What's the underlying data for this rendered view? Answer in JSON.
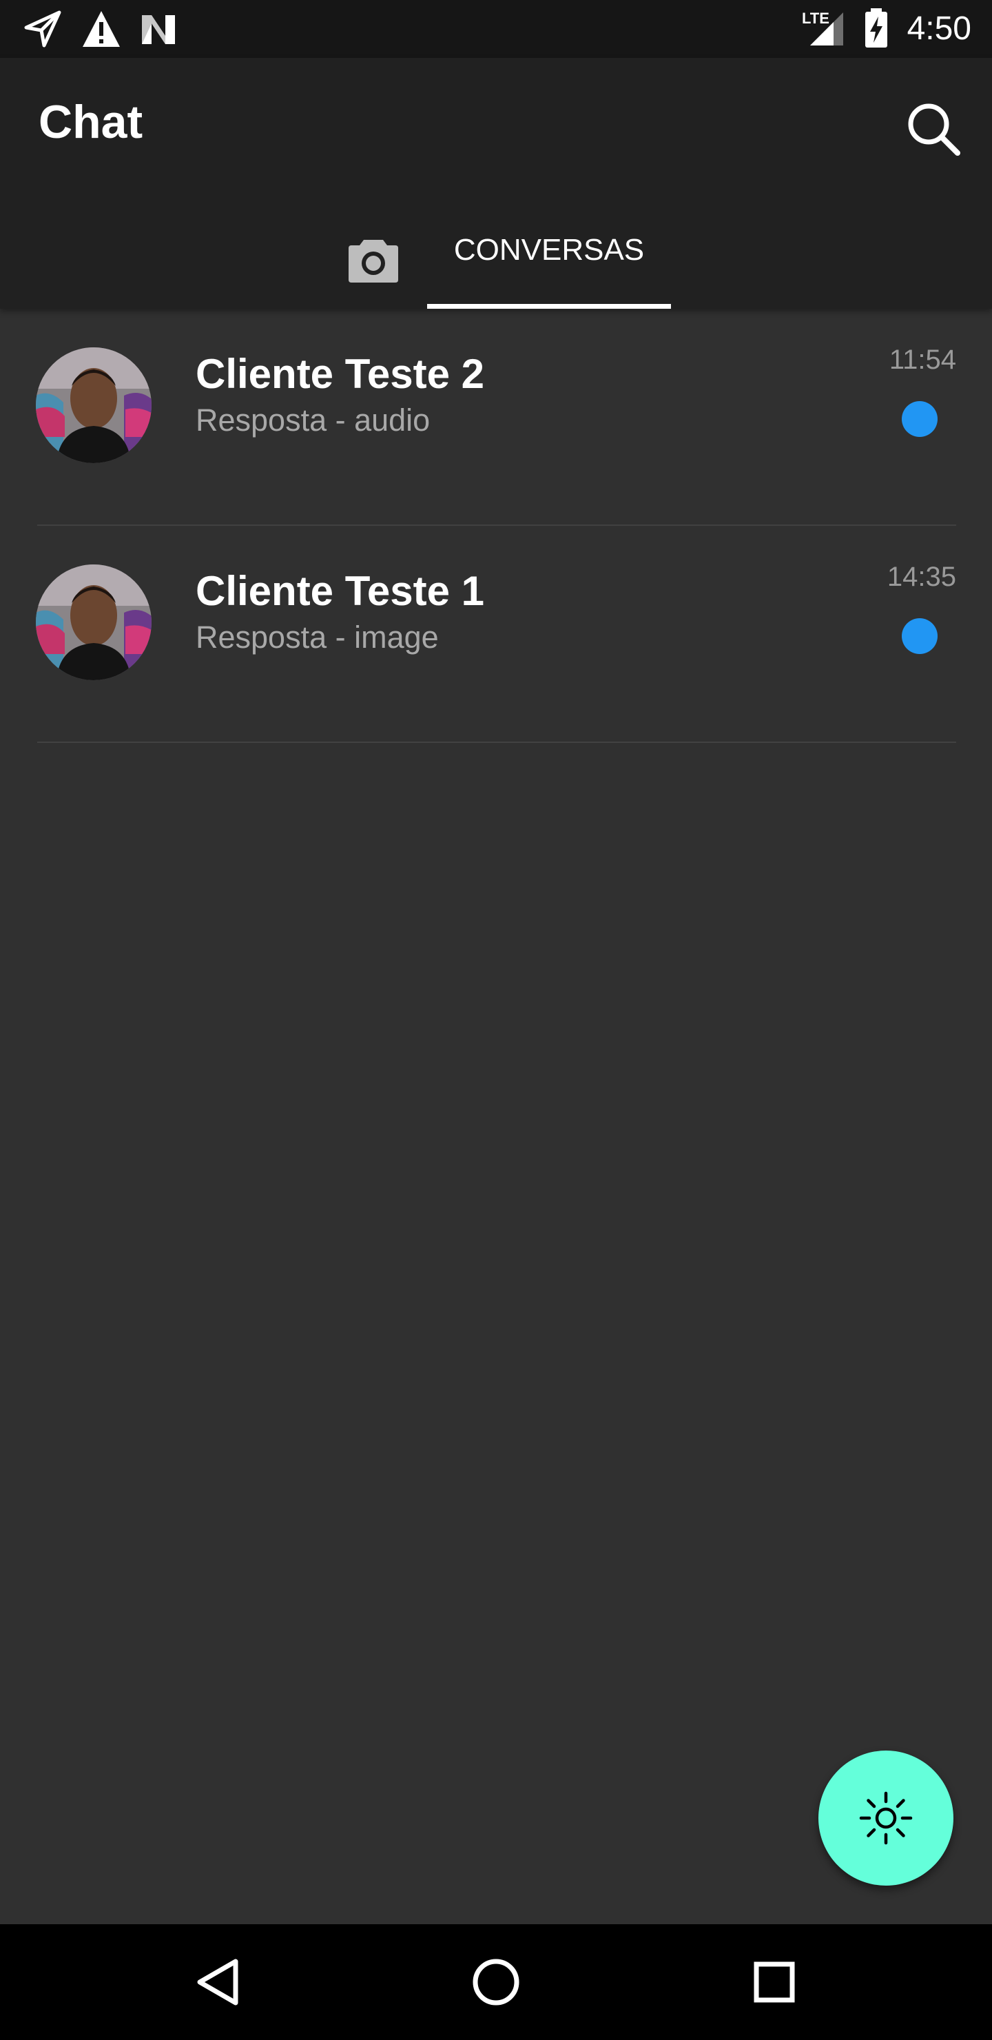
{
  "status_bar": {
    "time": "4:50",
    "network_label": "LTE",
    "icons": [
      "send-icon",
      "warning-icon",
      "n-logo-icon",
      "signal-icon",
      "battery-charging-icon"
    ]
  },
  "app_bar": {
    "title": "Chat",
    "search_icon": "search-icon",
    "tabs": [
      {
        "icon": "camera-icon",
        "label": ""
      },
      {
        "label": "CONVERSAS",
        "selected": true
      }
    ]
  },
  "chats": [
    {
      "name": "Cliente Teste 2",
      "preview": "Resposta - audio",
      "time": "11:54",
      "unread": true
    },
    {
      "name": "Cliente Teste 1",
      "preview": "Resposta - image",
      "time": "14:35",
      "unread": true
    }
  ],
  "fab": {
    "icon": "sun-icon"
  },
  "nav_bar": {
    "icons": [
      "back-icon",
      "home-icon",
      "recents-icon"
    ]
  },
  "colors": {
    "background": "#303030",
    "app_bar": "#212121",
    "status_bar": "#161616",
    "unread_dot": "#2196f3",
    "fab": "#64ffda",
    "divider": "#414141"
  }
}
